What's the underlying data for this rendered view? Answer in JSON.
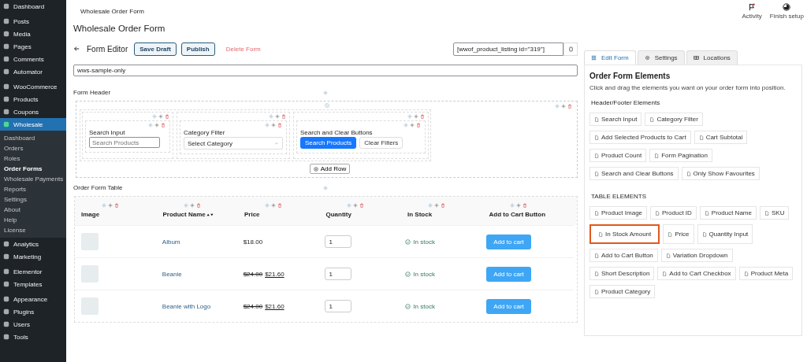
{
  "sidebar": {
    "groups": [
      {
        "items": [
          {
            "label": "Dashboard",
            "selected": false
          }
        ]
      },
      {
        "items": [
          {
            "label": "Posts",
            "selected": false
          },
          {
            "label": "Media",
            "selected": false
          },
          {
            "label": "Pages",
            "selected": false
          },
          {
            "label": "Comments",
            "selected": false
          },
          {
            "label": "Automator",
            "selected": false
          }
        ]
      },
      {
        "items": [
          {
            "label": "WooCommerce",
            "selected": false
          },
          {
            "label": "Products",
            "selected": false
          },
          {
            "label": "Coupons",
            "selected": false
          },
          {
            "label": "Wholesale",
            "selected": true,
            "children": [
              {
                "label": "Dashboard",
                "selected": false
              },
              {
                "label": "Orders",
                "selected": false
              },
              {
                "label": "Roles",
                "selected": false
              },
              {
                "label": "Order Forms",
                "selected": true
              },
              {
                "label": "Wholesale Payments",
                "selected": false
              },
              {
                "label": "Reports",
                "selected": false
              },
              {
                "label": "Settings",
                "selected": false
              },
              {
                "label": "About",
                "selected": false
              },
              {
                "label": "Help",
                "selected": false
              },
              {
                "label": "License",
                "selected": false
              }
            ]
          },
          {
            "label": "Analytics",
            "selected": false
          },
          {
            "label": "Marketing",
            "selected": false
          }
        ]
      },
      {
        "items": [
          {
            "label": "Elementor",
            "selected": false
          },
          {
            "label": "Templates",
            "selected": false
          }
        ]
      },
      {
        "items": [
          {
            "label": "Appearance",
            "selected": false
          },
          {
            "label": "Plugins",
            "selected": false
          },
          {
            "label": "Users",
            "selected": false
          },
          {
            "label": "Tools",
            "selected": false
          }
        ]
      }
    ]
  },
  "topbar": {
    "title": "Wholesale Order Form",
    "actions": [
      {
        "label": "Activity",
        "kind": "flag"
      },
      {
        "label": "Finish setup",
        "kind": "progress"
      }
    ]
  },
  "page_title": "Wholesale Order Form",
  "editor": {
    "title": "Form Editor",
    "buttons": [
      "Save Draft",
      "Publish"
    ],
    "delete_link": "Delete Form",
    "shortcode": "[wwof_product_listing id=\"319\"]",
    "form_name": "wws-sample-only"
  },
  "form_header": {
    "label": "Form Header",
    "columns": [
      {
        "kind": "search_input",
        "label": "Search Input",
        "placeholder": "Search Products"
      },
      {
        "kind": "category_filter",
        "label": "Category Filter",
        "value": "Select Category"
      },
      {
        "kind": "search_buttons",
        "label": "Search and Clear Buttons",
        "buttons": [
          "Search Products",
          "Clear Filters"
        ]
      }
    ],
    "add_row": "Add Row"
  },
  "order_table": {
    "label": "Order Form Table",
    "columns": [
      {
        "label": "Image",
        "sortable": false
      },
      {
        "label": "Product Name",
        "sortable": true
      },
      {
        "label": "Price",
        "sortable": false
      },
      {
        "label": "Quantity",
        "sortable": false
      },
      {
        "label": "In Stock",
        "sortable": false
      },
      {
        "label": "Add to Cart Button",
        "sortable": false
      }
    ],
    "rows": [
      {
        "name": "Album",
        "price": "$18.00",
        "quantity": "1",
        "stock": "In stock",
        "button": "Add to cart"
      },
      {
        "name": "Beanie",
        "regular_price": "$24.00",
        "sale_price": "$21.60",
        "quantity": "1",
        "stock": "In stock",
        "button": "Add to cart"
      },
      {
        "name": "Beanie with Logo",
        "regular_price": "$24.00",
        "sale_price": "$21.60",
        "quantity": "1",
        "stock": "In stock",
        "button": "Add to cart"
      }
    ]
  },
  "panel": {
    "tabs": [
      {
        "label": "Edit Form",
        "selected": true
      },
      {
        "label": "Settings",
        "selected": false
      },
      {
        "label": "Locations",
        "selected": false
      }
    ],
    "heading": "Order Form Elements",
    "description": "Click and drag the elements you want on your order form into position.",
    "header_title": "Header/Footer Elements",
    "header_elements": [
      {
        "label": "Search Input"
      },
      {
        "label": "Category Filter"
      },
      {
        "label": "Add Selected Products to Cart"
      },
      {
        "label": "Cart Subtotal"
      },
      {
        "label": "Product Count"
      },
      {
        "label": "Form Pagination"
      },
      {
        "label": "Search and Clear Buttons"
      },
      {
        "label": "Only Show Favourites"
      }
    ],
    "table_title": "TABLE ELEMENTS",
    "table_elements": [
      {
        "label": "Product Image",
        "highlighted": false
      },
      {
        "label": "Product ID",
        "highlighted": false
      },
      {
        "label": "Product Name",
        "highlighted": false
      },
      {
        "label": "SKU",
        "highlighted": false
      },
      {
        "label": "In Stock Amount",
        "highlighted": true
      },
      {
        "label": "Price",
        "highlighted": false
      },
      {
        "label": "Quantity Input",
        "highlighted": false
      },
      {
        "label": "Add to Cart Button",
        "highlighted": false
      },
      {
        "label": "Variation Dropdown",
        "highlighted": false
      },
      {
        "label": "Short Description",
        "highlighted": false
      },
      {
        "label": "Add to Cart Checkbox",
        "highlighted": false
      },
      {
        "label": "Product Meta",
        "highlighted": false
      },
      {
        "label": "Product Category",
        "highlighted": false
      }
    ]
  }
}
